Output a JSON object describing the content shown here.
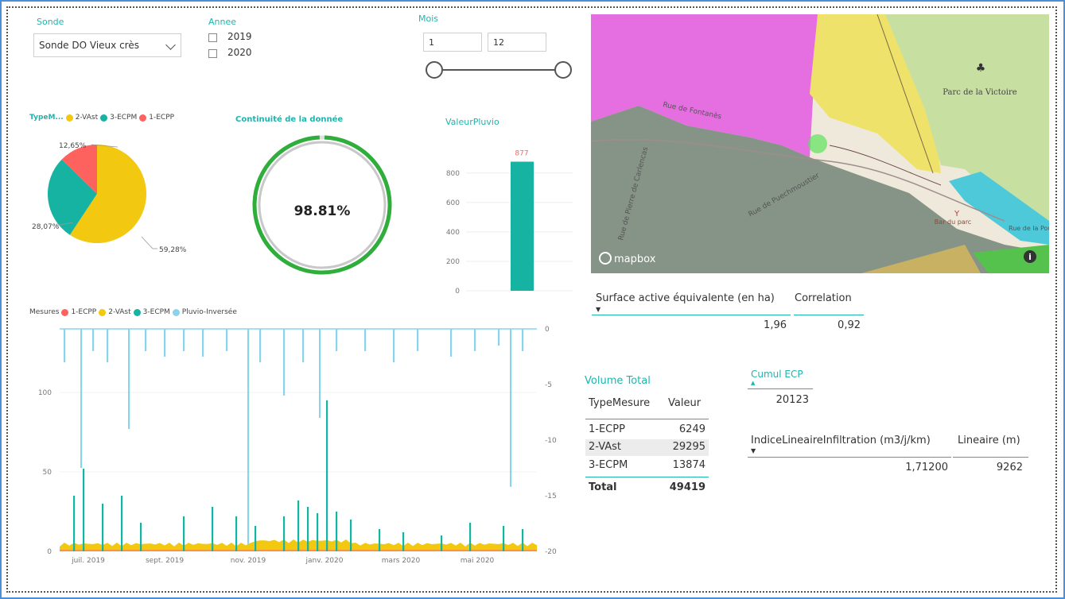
{
  "filters": {
    "sonde": {
      "label": "Sonde",
      "value": "Sonde DO Vieux crès"
    },
    "annee": {
      "label": "Annee",
      "options": [
        "2019",
        "2020"
      ]
    },
    "mois": {
      "label": "Mois",
      "min": "1",
      "max": "12"
    }
  },
  "pie": {
    "legend_title": "TypeM...",
    "chart_data": {
      "type": "pie",
      "series": [
        {
          "name": "2-VAst",
          "value": 59.28,
          "label": "59,28%",
          "color": "#f2c811"
        },
        {
          "name": "3-ECPM",
          "value": 28.07,
          "label": "28,07%",
          "color": "#16b3a3"
        },
        {
          "name": "1-ECPP",
          "value": 12.65,
          "label": "12,65%",
          "color": "#fd625e"
        }
      ]
    }
  },
  "gauge": {
    "title": "Continuité de la donnée",
    "value_text": "98.81%",
    "fraction": 0.9881,
    "color": "#2fae3b"
  },
  "pluvio_bar": {
    "title": "ValeurPluvio",
    "chart_data": {
      "type": "bar",
      "categories": [
        ""
      ],
      "values": [
        877
      ],
      "value_label": "877",
      "ylim": [
        0,
        950
      ],
      "yticks": [
        "0",
        "200",
        "400",
        "600",
        "800"
      ],
      "color": "#16b3a3"
    }
  },
  "timeseries": {
    "legend_title": "Mesures",
    "legend": [
      {
        "name": "1-ECPP",
        "color": "#fd625e"
      },
      {
        "name": "2-VAst",
        "color": "#f2c811"
      },
      {
        "name": "3-ECPM",
        "color": "#16b3a3"
      },
      {
        "name": "Pluvio-Inversée",
        "color": "#8ad4eb"
      }
    ],
    "chart_data": {
      "type": "area",
      "x_ticks": [
        "juil. 2019",
        "sept. 2019",
        "nov. 2019",
        "janv. 2020",
        "mars 2020",
        "mai 2020"
      ],
      "y_left_ticks": [
        "0",
        "50",
        "100"
      ],
      "y_right_ticks": [
        "0",
        "-5",
        "-10",
        "-15",
        "-20"
      ],
      "ylim_left": [
        0,
        140
      ],
      "ylim_right": [
        -20,
        0
      ],
      "ecpm_peaks": [
        [
          0.03,
          35
        ],
        [
          0.05,
          52
        ],
        [
          0.09,
          30
        ],
        [
          0.13,
          35
        ],
        [
          0.17,
          18
        ],
        [
          0.26,
          22
        ],
        [
          0.32,
          28
        ],
        [
          0.37,
          22
        ],
        [
          0.41,
          16
        ],
        [
          0.47,
          22
        ],
        [
          0.5,
          32
        ],
        [
          0.52,
          28
        ],
        [
          0.54,
          24
        ],
        [
          0.56,
          95
        ],
        [
          0.58,
          25
        ],
        [
          0.61,
          20
        ],
        [
          0.67,
          14
        ],
        [
          0.72,
          12
        ],
        [
          0.8,
          10
        ],
        [
          0.86,
          18
        ],
        [
          0.93,
          16
        ],
        [
          0.97,
          14
        ]
      ],
      "pluvio_drops": [
        [
          0.01,
          -3
        ],
        [
          0.045,
          -12.5
        ],
        [
          0.07,
          -2
        ],
        [
          0.1,
          -3
        ],
        [
          0.145,
          -9
        ],
        [
          0.18,
          -2
        ],
        [
          0.22,
          -2.5
        ],
        [
          0.26,
          -2
        ],
        [
          0.3,
          -2.5
        ],
        [
          0.35,
          -2
        ],
        [
          0.395,
          -20
        ],
        [
          0.42,
          -3
        ],
        [
          0.47,
          -6
        ],
        [
          0.51,
          -3
        ],
        [
          0.545,
          -8
        ],
        [
          0.58,
          -2
        ],
        [
          0.64,
          -2
        ],
        [
          0.7,
          -3
        ],
        [
          0.75,
          -2
        ],
        [
          0.82,
          -2.5
        ],
        [
          0.87,
          -2
        ],
        [
          0.92,
          -1.5
        ],
        [
          0.945,
          -14.2
        ],
        [
          0.97,
          -2
        ]
      ]
    }
  },
  "map": {
    "place": "Parc de la Victoire",
    "road1": "Rue de Fontanès",
    "road2": "Rue de Puechmoustier",
    "road3": "Rue de Pierre de Carlencas",
    "road4": "Rue de la Poupe",
    "poi": "Bar du parc",
    "brand": "mapbox",
    "info": "i"
  },
  "surface": {
    "col1": "Surface active équivalente (en ha)",
    "col2": "Correlation",
    "v1": "1,96",
    "v2": "0,92"
  },
  "volume": {
    "title": "Volume Total",
    "header": [
      "TypeMesure",
      "Valeur"
    ],
    "rows": [
      [
        "1-ECPP",
        "6249"
      ],
      [
        "2-VAst",
        "29295"
      ],
      [
        "3-ECPM",
        "13874"
      ]
    ],
    "total": [
      "Total",
      "49419"
    ]
  },
  "cumul": {
    "title": "Cumul ECP",
    "value": "20123"
  },
  "lineaire": {
    "col1": "IndiceLineaireInfiltration (m3/j/km)",
    "col2": "Lineaire (m)",
    "v1": "1,71200",
    "v2": "9262"
  }
}
